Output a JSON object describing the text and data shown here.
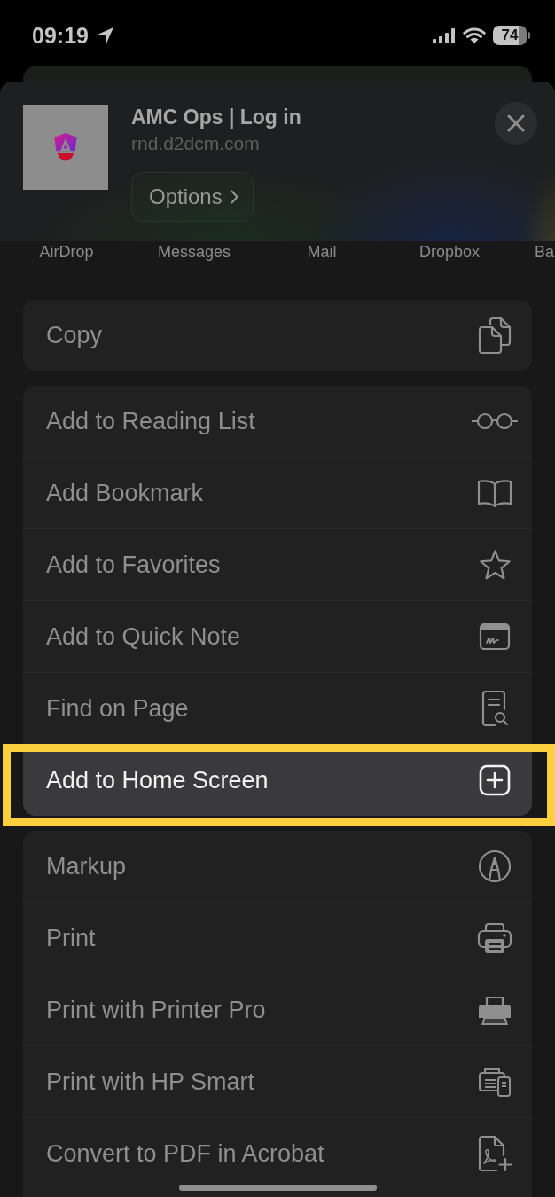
{
  "status_bar": {
    "time": "09:19",
    "battery": "74"
  },
  "share_header": {
    "title": "AMC Ops | Log in",
    "url": "rnd.d2dcm.com",
    "options_button": "Options"
  },
  "share_targets": [
    {
      "label": "AirDrop"
    },
    {
      "label": "Messages"
    },
    {
      "label": "Mail"
    },
    {
      "label": "Dropbox"
    },
    {
      "label": "Ba"
    }
  ],
  "action_groups": [
    {
      "items": [
        {
          "label": "Copy",
          "kind": "copy",
          "highlighted": false
        }
      ]
    },
    {
      "items": [
        {
          "label": "Add to Reading List",
          "kind": "reading-list",
          "highlighted": false
        },
        {
          "label": "Add Bookmark",
          "kind": "bookmark",
          "highlighted": false
        },
        {
          "label": "Add to Favorites",
          "kind": "favorites",
          "highlighted": false
        },
        {
          "label": "Add to Quick Note",
          "kind": "quick-note",
          "highlighted": false
        },
        {
          "label": "Find on Page",
          "kind": "find",
          "highlighted": false
        },
        {
          "label": "Add to Home Screen",
          "kind": "home-screen",
          "highlighted": true
        }
      ]
    },
    {
      "items": [
        {
          "label": "Markup",
          "kind": "markup",
          "highlighted": false
        },
        {
          "label": "Print",
          "kind": "print",
          "highlighted": false
        },
        {
          "label": "Print with Printer Pro",
          "kind": "printer-pro",
          "highlighted": false
        },
        {
          "label": "Print with HP Smart",
          "kind": "hp-smart",
          "highlighted": false
        },
        {
          "label": "Convert to PDF in Acrobat",
          "kind": "acrobat",
          "highlighted": false
        }
      ]
    }
  ]
}
